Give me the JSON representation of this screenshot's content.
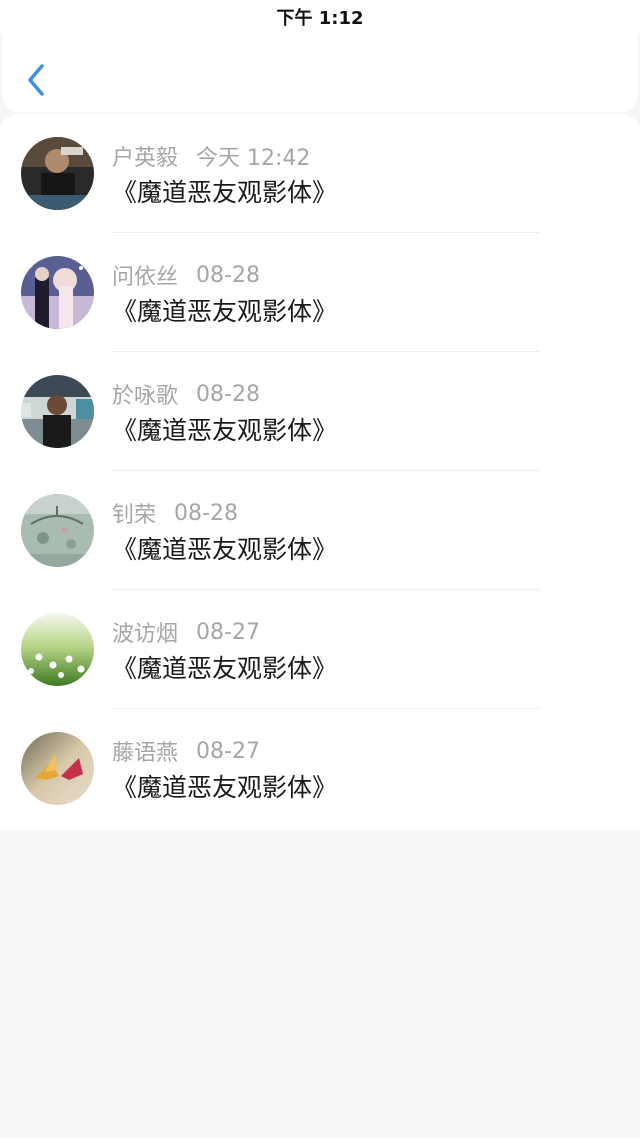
{
  "status_bar": {
    "time": "下午 1:12"
  },
  "nav": {
    "back_icon": "chevron-left-icon"
  },
  "colors": {
    "accent": "#3d8fe6",
    "name_text": "#a6a6a6",
    "title_text": "#1a1a1a"
  },
  "items": [
    {
      "name": "户英毅",
      "time": "今天 12:42",
      "title": "《魔道恶友观影体》"
    },
    {
      "name": "问依丝",
      "time": "08-28",
      "title": "《魔道恶友观影体》"
    },
    {
      "name": "於咏歌",
      "time": "08-28",
      "title": "《魔道恶友观影体》"
    },
    {
      "name": "钊荣",
      "time": "08-28",
      "title": "《魔道恶友观影体》"
    },
    {
      "name": "波访烟",
      "time": "08-27",
      "title": "《魔道恶友观影体》"
    },
    {
      "name": "藤语燕",
      "time": "08-27",
      "title": "《魔道恶友观影体》"
    }
  ]
}
